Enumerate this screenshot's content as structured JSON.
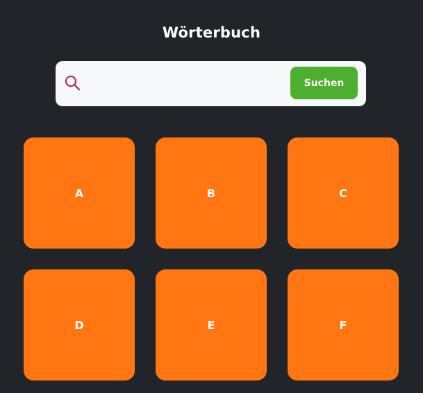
{
  "header": {
    "title": "Wörterbuch"
  },
  "search": {
    "icon": "search-icon",
    "placeholder": "",
    "value": "",
    "button_label": "Suchen"
  },
  "colors": {
    "background": "#212429",
    "search_bar": "#f6f8fa",
    "search_icon": "#b5305a",
    "button": "#4caf2f",
    "tile": "#ff7613",
    "text": "#ffffff"
  },
  "letters": [
    "A",
    "B",
    "C",
    "D",
    "E",
    "F"
  ]
}
